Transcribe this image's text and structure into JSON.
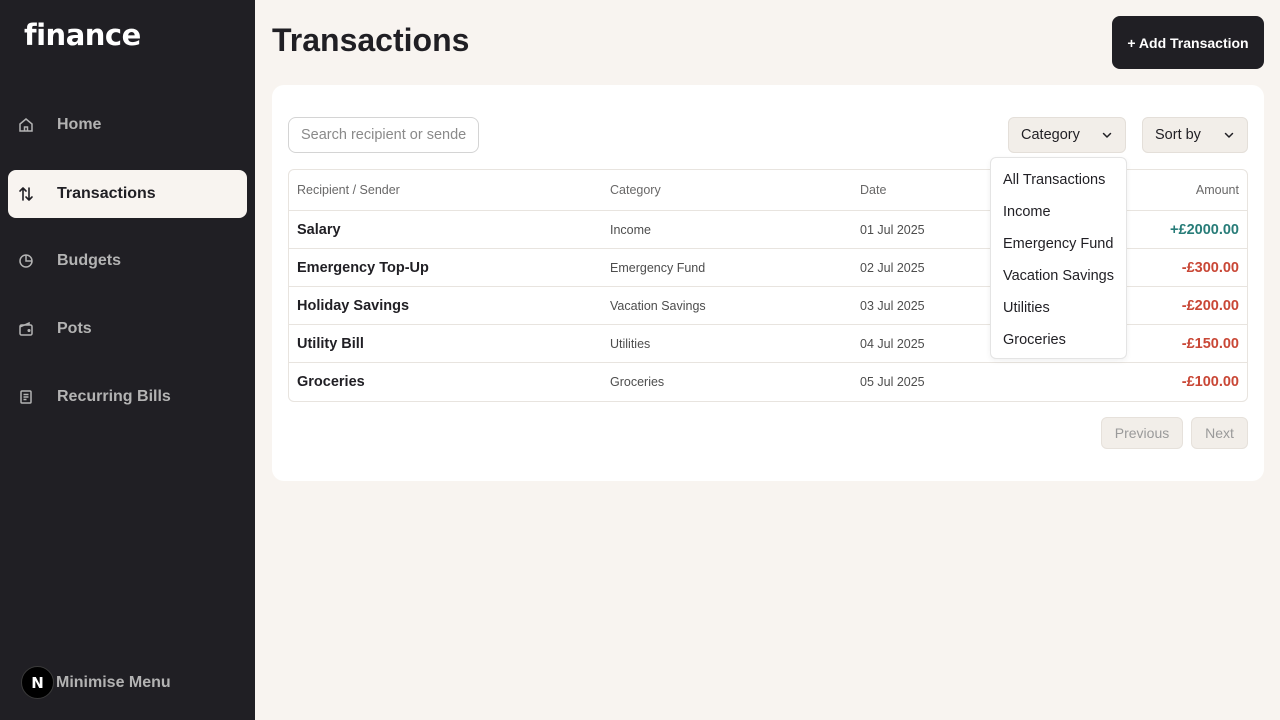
{
  "app": {
    "logo": "finance"
  },
  "sidebar": {
    "items": [
      {
        "label": "Home",
        "icon": "home-icon",
        "active": false
      },
      {
        "label": "Transactions",
        "icon": "arrows-up-down-icon",
        "active": true
      },
      {
        "label": "Budgets",
        "icon": "pie-chart-icon",
        "active": false
      },
      {
        "label": "Pots",
        "icon": "wallet-icon",
        "active": false
      },
      {
        "label": "Recurring Bills",
        "icon": "receipt-icon",
        "active": false
      }
    ],
    "minimise_label": "Minimise Menu",
    "avatar_letter": "N"
  },
  "header": {
    "title": "Transactions",
    "add_button": "+ Add Transaction"
  },
  "filters": {
    "search_placeholder": "Search recipient or sender",
    "category_label": "Category",
    "sort_label": "Sort by"
  },
  "table": {
    "headers": {
      "name": "Recipient / Sender",
      "category": "Category",
      "date": "Date",
      "amount": "Amount"
    },
    "rows": [
      {
        "name": "Salary",
        "category": "Income",
        "date": "01 Jul 2025",
        "amount": "+£2000.00",
        "sign": "pos"
      },
      {
        "name": "Emergency Top-Up",
        "category": "Emergency Fund",
        "date": "02 Jul 2025",
        "amount": "-£300.00",
        "sign": "neg"
      },
      {
        "name": "Holiday Savings",
        "category": "Vacation Savings",
        "date": "03 Jul 2025",
        "amount": "-£200.00",
        "sign": "neg"
      },
      {
        "name": "Utility Bill",
        "category": "Utilities",
        "date": "04 Jul 2025",
        "amount": "-£150.00",
        "sign": "neg"
      },
      {
        "name": "Groceries",
        "category": "Groceries",
        "date": "05 Jul 2025",
        "amount": "-£100.00",
        "sign": "neg"
      }
    ]
  },
  "category_menu": {
    "options": [
      "All Transactions",
      "Income",
      "Emergency Fund",
      "Vacation Savings",
      "Utilities",
      "Groceries"
    ]
  },
  "pagination": {
    "previous": "Previous",
    "next": "Next"
  },
  "colors": {
    "sidebar_bg": "#201f24",
    "page_bg": "#f8f4f0",
    "positive": "#277c78",
    "negative": "#c94736"
  }
}
